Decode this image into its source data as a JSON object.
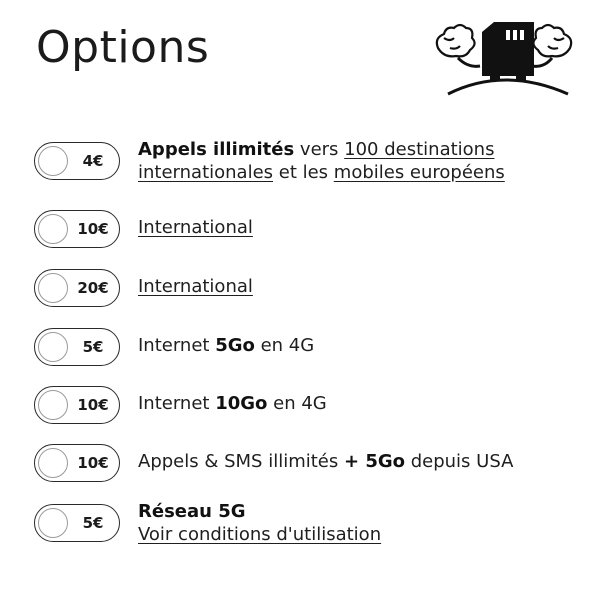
{
  "page": {
    "title": "Options"
  },
  "options": [
    {
      "price": "4€",
      "parts": [
        {
          "t": "Appels illimités",
          "s": "bold"
        },
        {
          "t": " vers ",
          "s": "plain"
        },
        {
          "t": "100 destinations internationales",
          "s": "link"
        },
        {
          "t": " et les ",
          "s": "plain"
        },
        {
          "t": "mobiles européens",
          "s": "link"
        }
      ]
    },
    {
      "price": "10€",
      "parts": [
        {
          "t": "International",
          "s": "link"
        }
      ]
    },
    {
      "price": "20€",
      "parts": [
        {
          "t": "International",
          "s": "link"
        }
      ]
    },
    {
      "price": "5€",
      "parts": [
        {
          "t": "Internet ",
          "s": "plain"
        },
        {
          "t": "5Go",
          "s": "bold"
        },
        {
          "t": " en 4G",
          "s": "plain"
        }
      ]
    },
    {
      "price": "10€",
      "parts": [
        {
          "t": "Internet ",
          "s": "plain"
        },
        {
          "t": "10Go",
          "s": "bold"
        },
        {
          "t": " en 4G",
          "s": "plain"
        }
      ]
    },
    {
      "price": "10€",
      "parts": [
        {
          "t": "Appels & SMS illimités ",
          "s": "plain"
        },
        {
          "t": "+ 5Go",
          "s": "bold"
        },
        {
          "t": " depuis USA",
          "s": "plain"
        }
      ]
    },
    {
      "price": "5€",
      "parts": [
        {
          "t": "Réseau 5G",
          "s": "bold"
        },
        {
          "t": "\n",
          "s": "break"
        },
        {
          "t": "Voir conditions d'utilisation",
          "s": "link"
        }
      ]
    }
  ],
  "icons": {
    "mascot": "sim-card-mascot-icon",
    "toggle": "radio-knob-icon"
  }
}
